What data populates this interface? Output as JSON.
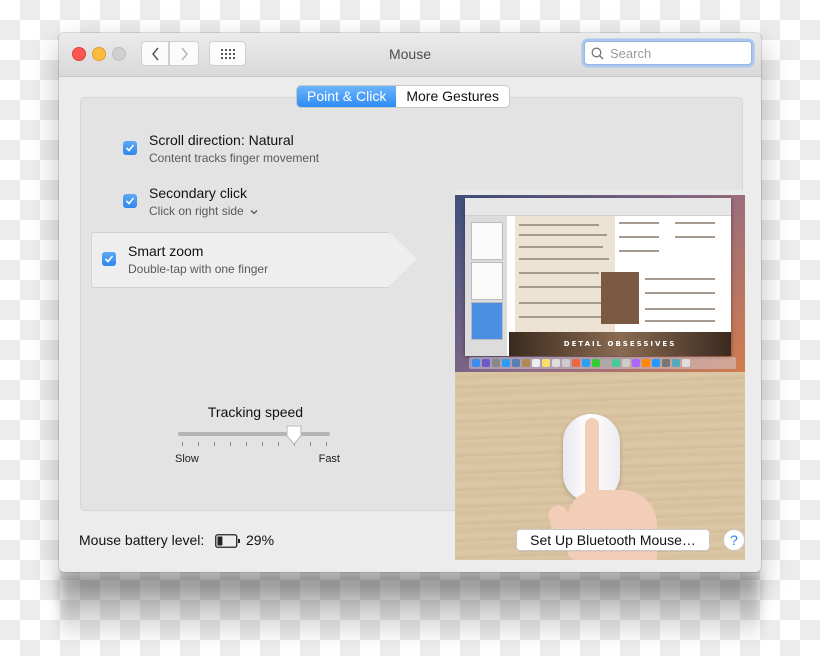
{
  "window": {
    "title": "Mouse",
    "search_placeholder": "Search"
  },
  "toolbar": {
    "back_icon": "chevron-left-icon",
    "forward_icon": "chevron-right-icon",
    "show_all_icon": "grid-icon"
  },
  "tabs": [
    {
      "label": "Point & Click",
      "active": true
    },
    {
      "label": "More Gestures",
      "active": false
    }
  ],
  "options": [
    {
      "label": "Scroll direction: Natural",
      "sublabel": "Content tracks finger movement",
      "checked": true
    },
    {
      "label": "Secondary click",
      "sublabel": "Click on right side",
      "has_dropdown": true,
      "checked": true
    },
    {
      "label": "Smart zoom",
      "sublabel": "Double-tap with one finger",
      "checked": true,
      "selected": true
    }
  ],
  "tracking": {
    "title": "Tracking speed",
    "min_label": "Slow",
    "max_label": "Fast",
    "tick_count": 10,
    "value_fraction": 0.78
  },
  "preview": {
    "banner_text": "DETAIL OBSESSIVES",
    "description": "Video preview: finger double-tapping Magic Mouse"
  },
  "footer": {
    "battery_label": "Mouse battery level:",
    "battery_percent": "29%",
    "battery_value": 0.29,
    "setup_button": "Set Up Bluetooth Mouse…",
    "help_label": "?"
  },
  "colors": {
    "accent": "#2f86ec",
    "close": "#fc5753",
    "minimize": "#fdbc40",
    "zoom_disabled": "#d0d0d0"
  }
}
